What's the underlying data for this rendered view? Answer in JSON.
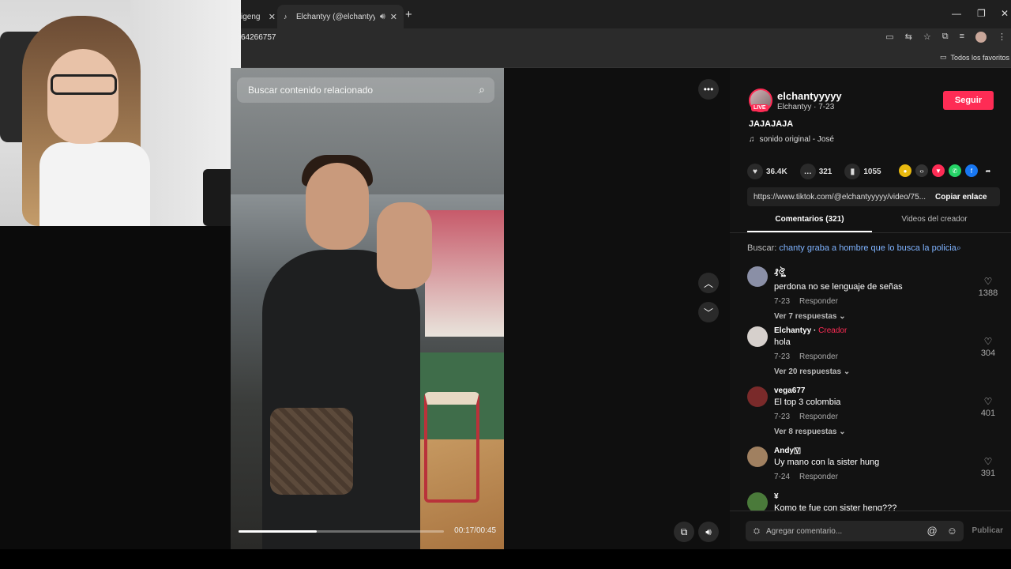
{
  "browser": {
    "inactive_tab_label": "igeng",
    "active_tab_label": "Elchantyy (@elchantyyyyy) |",
    "url_fragment": "64266757",
    "bookmarks_label": "Todos los favoritos"
  },
  "video": {
    "search_placeholder": "Buscar contenido relacionado",
    "time": "00:17/00:45",
    "progress_fraction": 0.38
  },
  "creator": {
    "username": "elchantyyyyy",
    "subtitle": "Elchantyy · 7-23",
    "live_badge": "LIVE",
    "follow_label": "Seguir",
    "description": "JAJAJAJA",
    "sound": "sonido original - José"
  },
  "stats": {
    "likes": "36.4K",
    "comments": "321",
    "saves": "1055"
  },
  "link": {
    "url": "https://www.tiktok.com/@elchantyyyyy/video/75...",
    "copy_label": "Copiar enlace"
  },
  "tabs": {
    "comments": "Comentarios (321)",
    "creator_videos": "Videos del creador"
  },
  "search_suggestion": {
    "prefix": "Buscar:",
    "query": "chanty graba a hombre que lo busca la policia"
  },
  "comments": [
    {
      "user": "₰ঔৣ",
      "text": "perdona no se lenguaje de señas",
      "date": "7-23",
      "reply": "Responder",
      "replies": "Ver 7 respuestas",
      "likes": "1388",
      "avatar_color": "#8a8fa6"
    },
    {
      "user": "Elchantyy",
      "creator_tag": "Creador",
      "text": "hola",
      "date": "7-23",
      "reply": "Responder",
      "replies": "Ver 20 respuestas",
      "likes": "304",
      "avatar_color": "#d6d0cc"
    },
    {
      "user": "vega677",
      "text": "El top 3 colombia",
      "date": "7-23",
      "reply": "Responder",
      "replies": "Ver 8 respuestas",
      "likes": "401",
      "avatar_color": "#7a2a2a"
    },
    {
      "user": "Andy🇻",
      "text": "Uy mano con la sister hung",
      "date": "7-24",
      "reply": "Responder",
      "likes": "391",
      "avatar_color": "#a08060"
    },
    {
      "user": "¥",
      "text": "Komo te fue con sister heng???",
      "avatar_color": "#4a7a3a"
    }
  ],
  "add_comment": {
    "placeholder": "Agregar comentario...",
    "publish_label": "Publicar"
  },
  "icons": {
    "more": "more-icon",
    "up": "chevron-up-icon",
    "down": "chevron-down-icon",
    "volume": "volume-icon",
    "pip": "picture-in-picture-icon"
  },
  "colors": {
    "accent": "#fe2c55",
    "link": "#7fb3ff"
  }
}
